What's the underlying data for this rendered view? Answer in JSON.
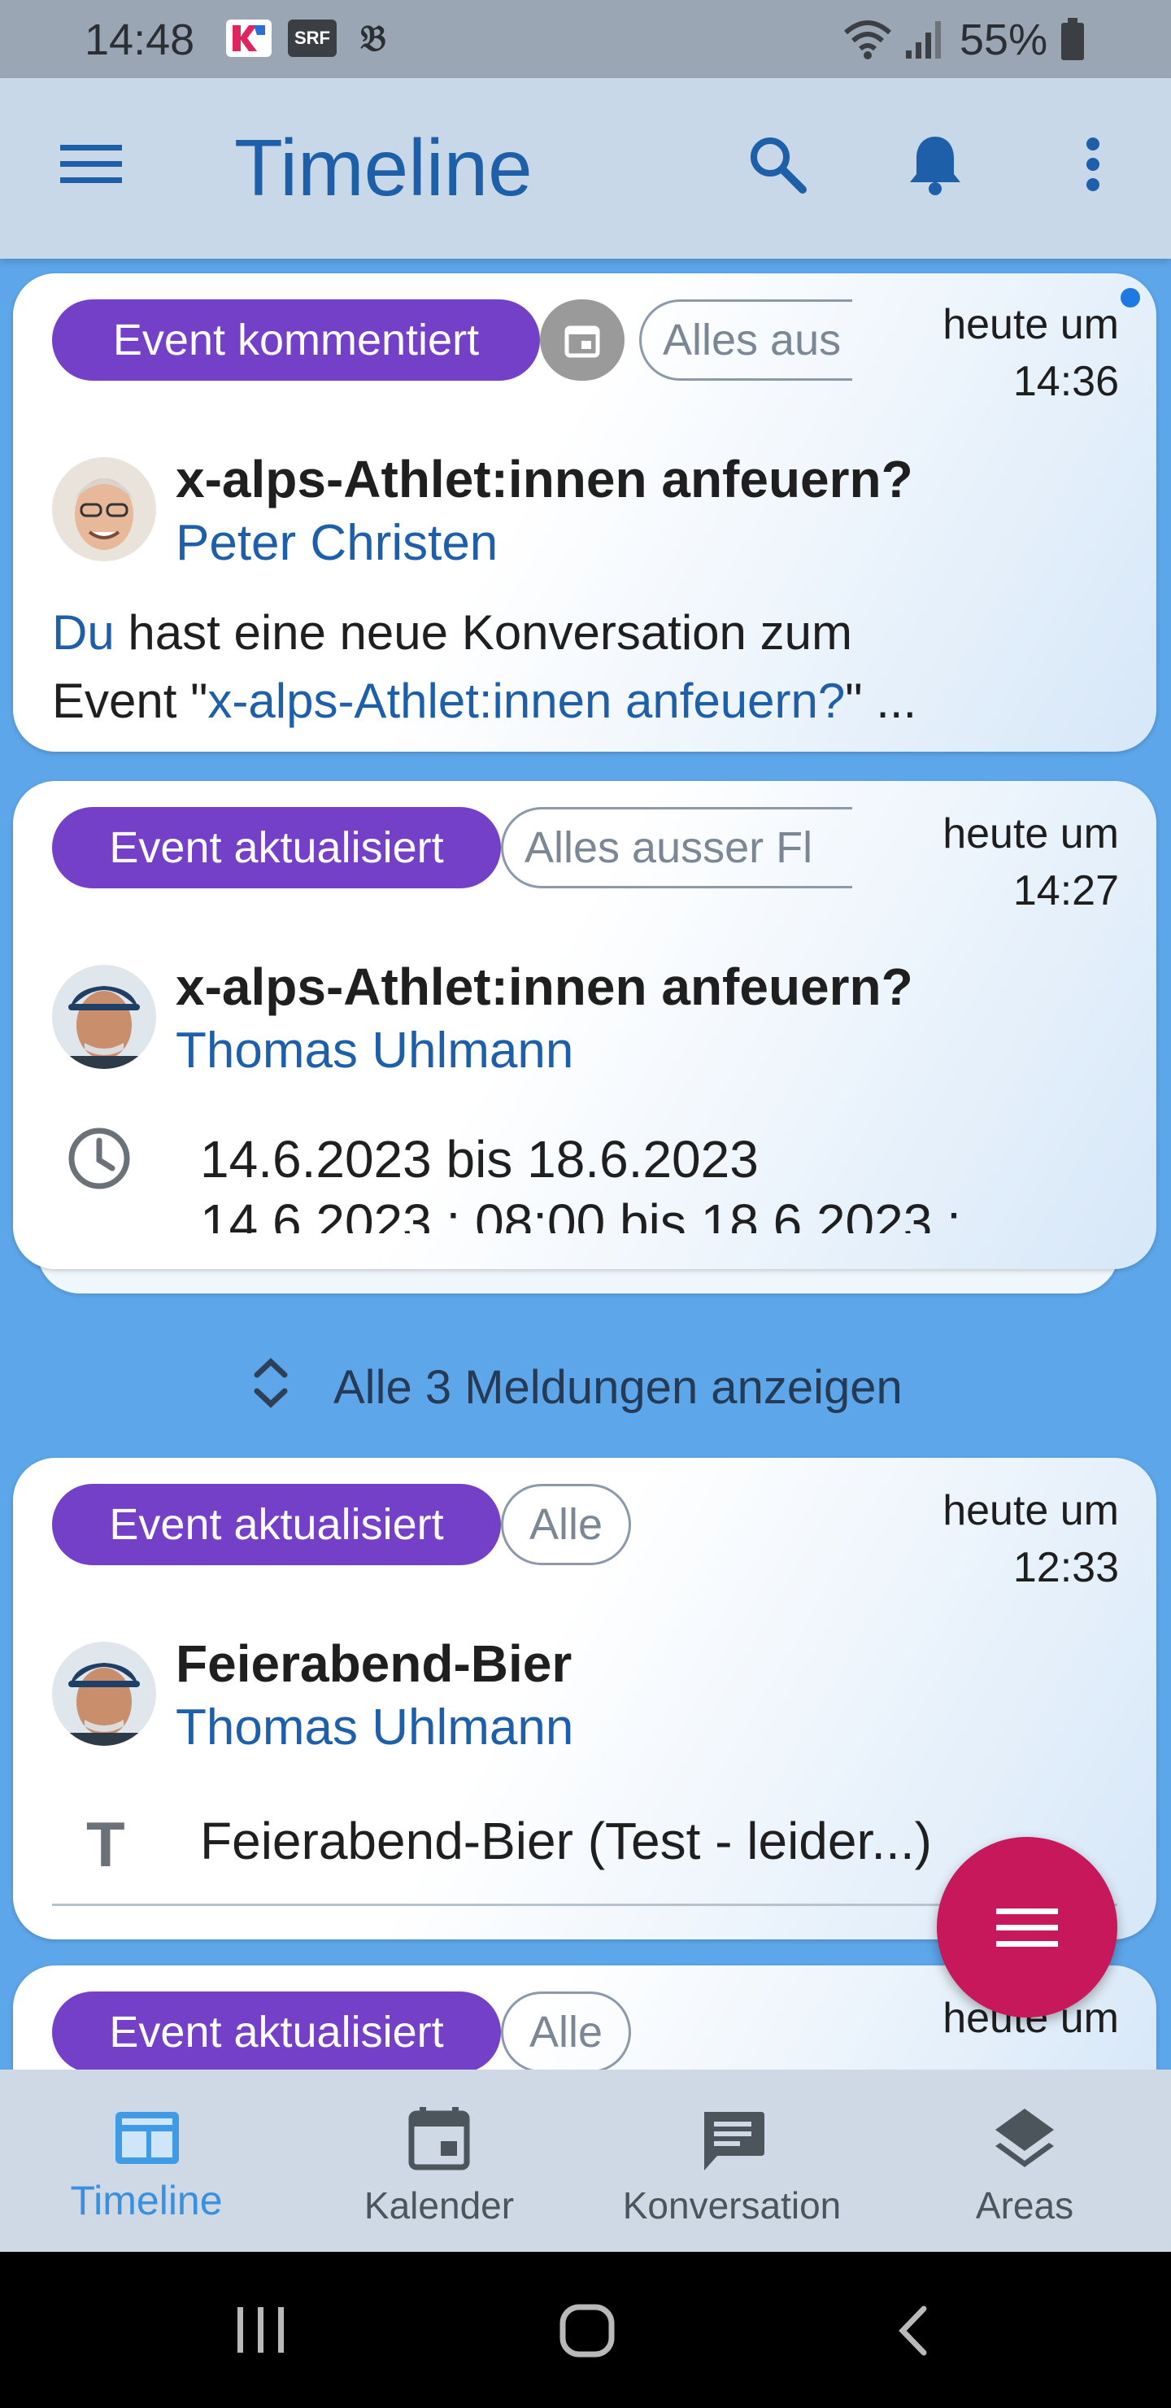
{
  "status_bar": {
    "time": "14:48",
    "battery": "55%",
    "icons": [
      "kr-app-icon",
      "srf-app-icon",
      "newspaper-app-icon",
      "wifi-icon",
      "signal-icon",
      "battery-icon"
    ],
    "srf_label": "SRF"
  },
  "app_bar": {
    "title": "Timeline",
    "icons": [
      "menu-icon",
      "search-icon",
      "bell-icon",
      "more-vert-icon"
    ]
  },
  "cards": [
    {
      "badge": "Event kommentiert",
      "tag": "Alles aus",
      "timestamp_line1": "heute um",
      "timestamp_line2": "14:36",
      "title": "x-alps-Athlet:innen anfeuern?",
      "author": "Peter Christen",
      "body_link1": "Du",
      "body_text1": " hast eine neue Konversation zum",
      "body_text2": "Event \"",
      "body_link2": "x-alps-Athlet:innen anfeuern?",
      "body_text3": "\" ..."
    },
    {
      "badge": "Event aktualisiert",
      "tag": "Alles ausser Fl",
      "timestamp_line1": "heute um",
      "timestamp_line2": "14:27",
      "title": "x-alps-Athlet:innen anfeuern?",
      "author": "Thomas Uhlmann",
      "date_range": "14.6.2023 bis 18.6.2023",
      "date_range_detail": "14.6.2023 : 08:00 bis 18.6.2023 :"
    },
    {
      "badge": "Event aktualisiert",
      "tag": "Alle",
      "timestamp_line1": "heute um",
      "timestamp_line2": "12:33",
      "title": "Feierabend-Bier",
      "author": "Thomas Uhlmann",
      "text_line": "Feierabend-Bier (Test - leider...)"
    },
    {
      "badge": "Event aktualisiert",
      "tag": "Alle",
      "timestamp_line1": "heute um"
    }
  ],
  "expander": {
    "label": "Alle 3 Meldungen anzeigen"
  },
  "bottom_nav": {
    "items": [
      {
        "label": "Timeline",
        "icon": "timeline-icon",
        "active": true
      },
      {
        "label": "Kalender",
        "icon": "calendar-icon",
        "active": false
      },
      {
        "label": "Konversation",
        "icon": "chat-icon",
        "active": false
      },
      {
        "label": "Areas",
        "icon": "layers-icon",
        "active": false
      }
    ]
  },
  "colors": {
    "background": "#5da6ea",
    "accent_blue": "#1d5fa8",
    "badge_purple": "#7440c8",
    "fab": "#c6185a",
    "unread_dot": "#1e7ae0"
  }
}
